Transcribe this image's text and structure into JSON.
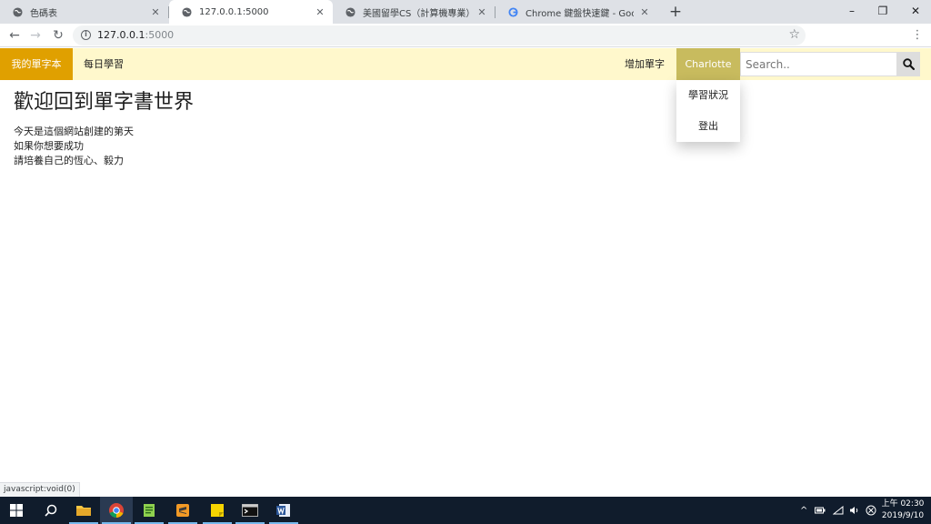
{
  "browser": {
    "tabs": [
      {
        "title": "色碼表",
        "active": false,
        "icon": "globe-icon"
      },
      {
        "title": "127.0.0.1:5000",
        "active": true,
        "icon": "globe-icon"
      },
      {
        "title": "美國留學CS（計算機專業）專業",
        "active": false,
        "icon": "globe-icon"
      },
      {
        "title": "Chrome 鍵盤快速鍵 - Google Ch",
        "active": false,
        "icon": "google-icon"
      }
    ],
    "url_host": "127.0.0.1",
    "url_port": ":5000",
    "status_text": "javascript:void(0)"
  },
  "site": {
    "brand": "我的單字本",
    "nav_left": [
      "每日學習"
    ],
    "nav_add": "增加單字",
    "user": "Charlotte",
    "search_placeholder": "Search..",
    "dropdown": [
      "學習狀況",
      "登出"
    ],
    "brand_color": "#e0a000",
    "nav_bg": "#fff8cc",
    "user_bg": "#c8bb5e"
  },
  "content": {
    "heading": "歡迎回到單字書世界",
    "lines": [
      "今天是這個網站創建的第天",
      "如果你想要成功",
      "請培養自己的恆心、毅力"
    ]
  },
  "taskbar": {
    "time": "上午 02:30",
    "date": "2019/9/10"
  }
}
